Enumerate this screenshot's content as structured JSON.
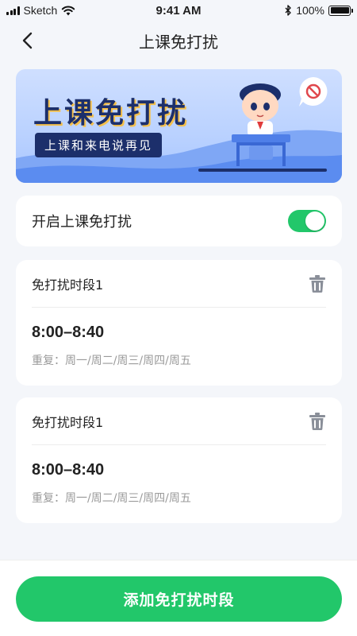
{
  "status_bar": {
    "carrier": "Sketch",
    "time": "9:41 AM",
    "battery": "100%",
    "icons": [
      "signal-icon",
      "wifi-icon",
      "bluetooth-icon",
      "battery-icon"
    ]
  },
  "nav": {
    "title": "上课免打扰",
    "back_icon": "chevron-left-icon"
  },
  "banner": {
    "title": "上课免打扰",
    "subtitle": "上课和来电说再见"
  },
  "toggle_setting": {
    "label": "开启上课免打扰",
    "enabled": true
  },
  "periods": [
    {
      "name": "免打扰时段1",
      "time": "8:00–8:40",
      "repeat": "重复：周一/周二/周三/周四/周五"
    },
    {
      "name": "免打扰时段1",
      "time": "8:00–8:40",
      "repeat": "重复：周一/周二/周三/周四/周五"
    }
  ],
  "add_button": {
    "label": "添加免打扰时段"
  },
  "colors": {
    "accent": "#22c76a",
    "background": "#f4f6fa",
    "banner_dark": "#1c2f6b"
  }
}
